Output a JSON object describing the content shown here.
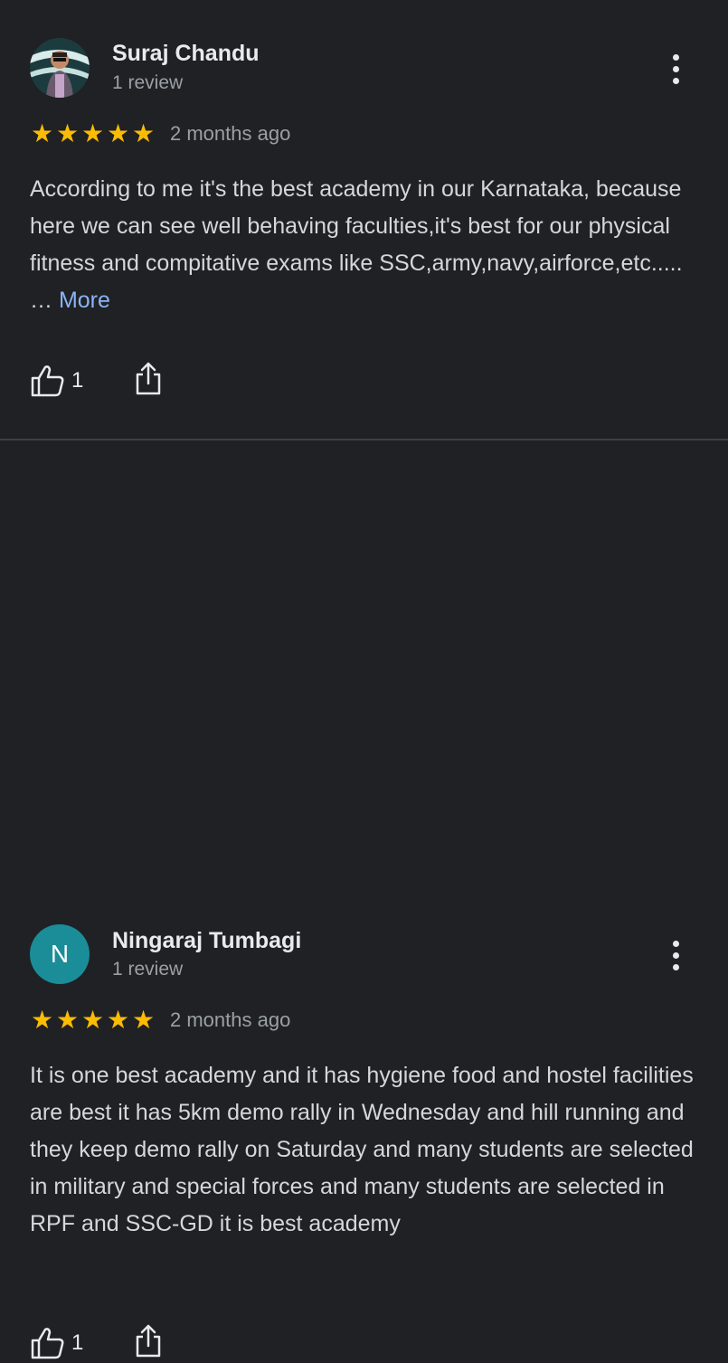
{
  "reviews": [
    {
      "author": "Suraj Chandu",
      "meta": "1 review",
      "rating": 5,
      "time": "2 months ago",
      "text": "According to me it's the best academy in our Karnataka, because here we can see well behaving faculties,it's best for our physical fitness and compitative exams like SSC,army,navy,airforce,etc..... …",
      "more_label": "More",
      "likes": "1",
      "avatar_icon": "profile-photo"
    },
    {
      "author": "Ningaraj Tumbagi",
      "meta": "1 review",
      "avatar_letter": "N",
      "rating": 5,
      "time": "2 months ago",
      "text": "It is one best academy and it has hygiene food and hostel facilities are best it has 5km demo rally in Wednesday and hill running and they keep demo rally on Saturday and many students are selected in military and special forces and many students are selected in RPF and SSC-GD it is best academy",
      "likes": "1"
    }
  ],
  "colors": {
    "background": "#202124",
    "star": "#fbbc04",
    "link": "#8ab4f8",
    "avatar_bg": "#1a8d99"
  },
  "icons": {
    "like": "thumbs-up-icon",
    "share": "share-icon",
    "more": "more-vert-icon"
  }
}
